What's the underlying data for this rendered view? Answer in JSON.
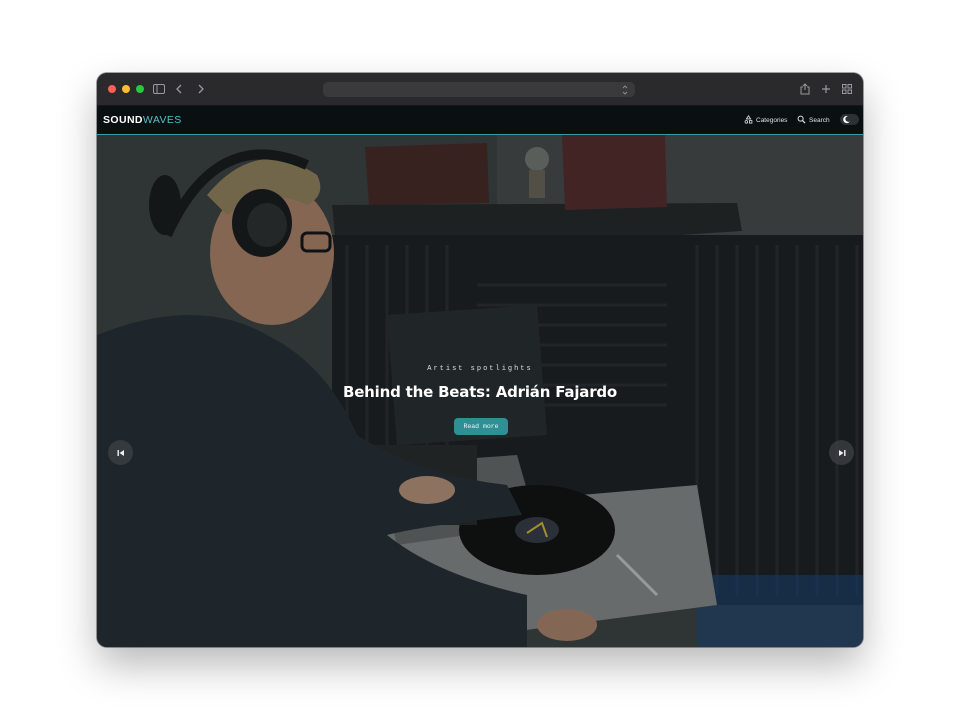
{
  "browser": {
    "url": ""
  },
  "site": {
    "logo_part1": "SOUND",
    "logo_part2": "WAVES",
    "nav": {
      "categories_label": "Categories",
      "search_label": "Search"
    }
  },
  "hero": {
    "eyebrow": "Artist spotlights",
    "title": "Behind the Beats: Adrián Fajardo",
    "cta_label": "Read more"
  },
  "icons": {
    "sidebar": "sidebar-icon",
    "back": "chevron-left-icon",
    "forward": "chevron-right-icon",
    "share": "share-icon",
    "new_tab": "plus-icon",
    "tabs": "tab-overview-icon",
    "categories": "categories-icon",
    "search": "search-icon",
    "theme": "moon-icon",
    "prev": "skip-previous-icon",
    "next": "skip-next-icon",
    "scroll": "scroll-mouse-icon"
  },
  "colors": {
    "accent": "#2f8f94",
    "logo_accent": "#52c0c4",
    "nav_background": "#0a0f11"
  }
}
